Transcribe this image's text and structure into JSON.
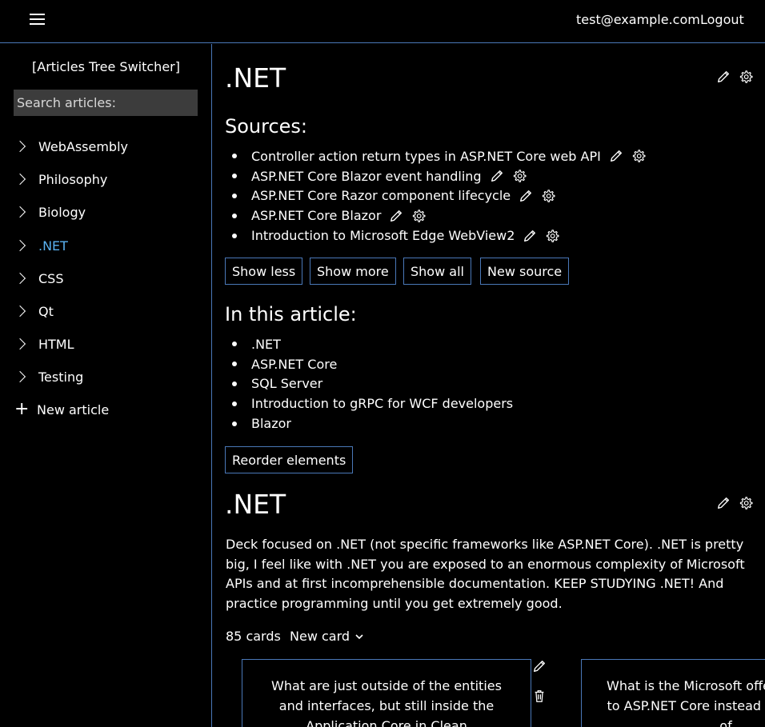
{
  "header": {
    "email": "test@example.com",
    "logout_label": "Logout"
  },
  "sidebar": {
    "switcher_label": "[Articles Tree Switcher]",
    "search_placeholder": "Search articles:",
    "items": [
      {
        "label": "WebAssembly"
      },
      {
        "label": "Philosophy"
      },
      {
        "label": "Biology"
      },
      {
        "label": ".NET",
        "active": true
      },
      {
        "label": "CSS"
      },
      {
        "label": "Qt"
      },
      {
        "label": "HTML"
      },
      {
        "label": "Testing"
      }
    ],
    "new_article_label": "New article"
  },
  "article": {
    "title": ".NET",
    "sources_heading": "Sources:",
    "sources": [
      "Controller action return types in ASP.NET Core web API",
      "ASP.NET Core Blazor event handling",
      "ASP.NET Core Razor component lifecycle",
      "ASP.NET Core Blazor",
      "Introduction to Microsoft Edge WebView2"
    ],
    "buttons": {
      "show_less": "Show less",
      "show_more": "Show more",
      "show_all": "Show all",
      "new_source": "New source"
    },
    "toc_heading": "In this article:",
    "toc": [
      ".NET",
      "ASP.NET Core",
      "SQL Server",
      "Introduction to gRPC for WCF developers",
      "Blazor"
    ],
    "reorder_label": "Reorder elements"
  },
  "section": {
    "title": ".NET",
    "description": "Deck focused on .NET (not specific frameworks like ASP.NET Core). .NET is pretty big, I feel like with .NET you are exposed to an enormous complexity of Microsoft APIs and at first incomprehensible documentation. KEEP STUDYING .NET! And practice programming until you get extremely good.",
    "cards_count": "85 cards",
    "new_card_label": "New card",
    "cards": [
      "What are just outside of the entities and interfaces, but still inside the Application Core in Clean Architecture?",
      "What is the Microsoft offering related to ASP.NET Core instead an evolution of"
    ]
  },
  "colors": {
    "accent_border": "#4a78b8",
    "active_link": "#5ab1f0",
    "search_bg": "#3c3c3c"
  },
  "icons": [
    "hamburger-icon",
    "chevron-right-icon",
    "plus-icon",
    "pencil-icon",
    "gear-icon",
    "trash-icon",
    "chevron-down-icon"
  ]
}
